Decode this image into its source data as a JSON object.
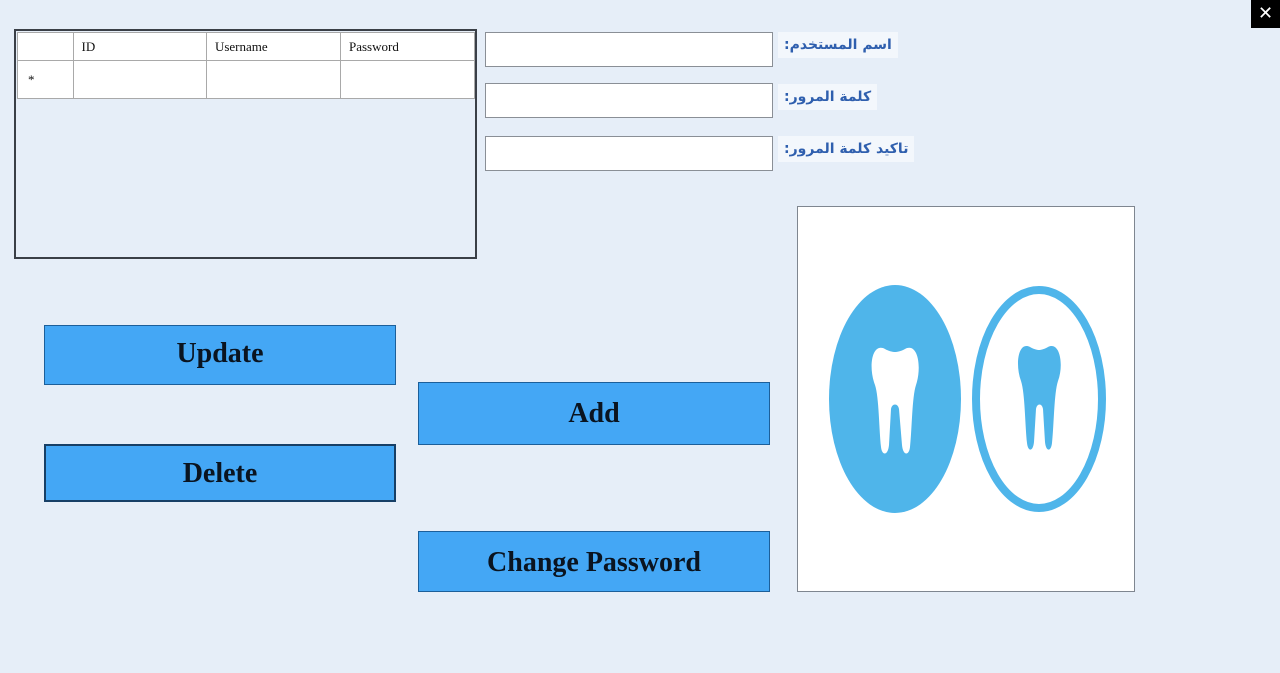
{
  "window": {
    "close_glyph": "✕"
  },
  "grid": {
    "columns": [
      "",
      "ID",
      "Username",
      "Password"
    ],
    "new_row_marker": "*"
  },
  "form": {
    "username_label": "اسم المستخدم:",
    "password_label": "كلمة المرور:",
    "confirm_label": "تاكيد كلمة المرور:",
    "username_value": "",
    "password_value": "",
    "confirm_value": ""
  },
  "buttons": {
    "update": "Update",
    "delete": "Delete",
    "add": "Add",
    "change_password": "Change Password"
  },
  "logo": {
    "icon": "dental-tooth-icon",
    "accent_color": "#4fb5ea"
  }
}
